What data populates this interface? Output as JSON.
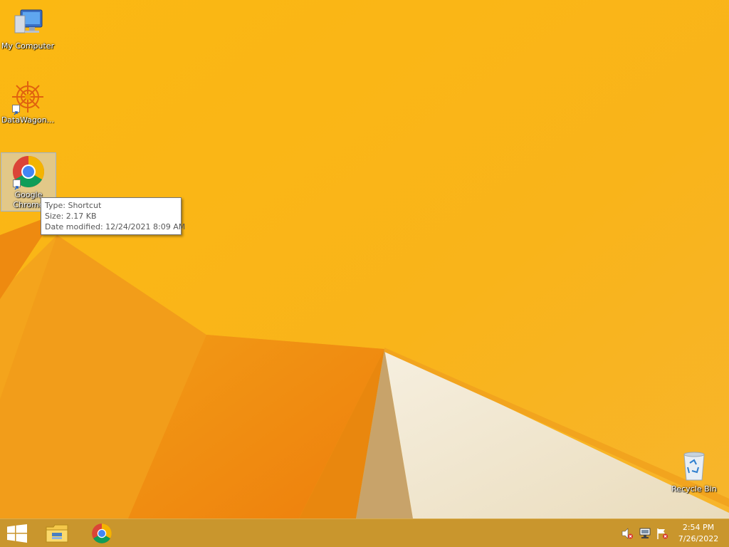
{
  "desktop": {
    "icons": [
      {
        "name": "my-computer",
        "label": "My Computer",
        "icon": "computer-icon"
      },
      {
        "name": "datawagon",
        "label": "DataWagon...",
        "icon": "datawagon-icon"
      },
      {
        "name": "google-chrome",
        "label": "Google Chrome",
        "icon": "chrome-icon",
        "selected": true
      },
      {
        "name": "recycle-bin",
        "label": "Recycle Bin",
        "icon": "recycle-bin-icon"
      }
    ]
  },
  "tooltip": {
    "type": "Type: Shortcut",
    "size": "Size: 2.17 KB",
    "modified": "Date modified: 12/24/2021 8:09 AM"
  },
  "taskbar": {
    "start": "windows-logo-icon",
    "pinned": [
      "file-explorer-icon",
      "chrome-icon"
    ],
    "tray": [
      "volume-muted-icon",
      "network-icon",
      "action-center-flag-icon"
    ],
    "clock": {
      "time": "2:54 PM",
      "date": "7/26/2022"
    }
  },
  "colors": {
    "wallpaper_base": "#f9b51a",
    "wallpaper_orange": "#f08a10",
    "wallpaper_cream": "#f3ead5",
    "taskbar": "#c9962d"
  }
}
